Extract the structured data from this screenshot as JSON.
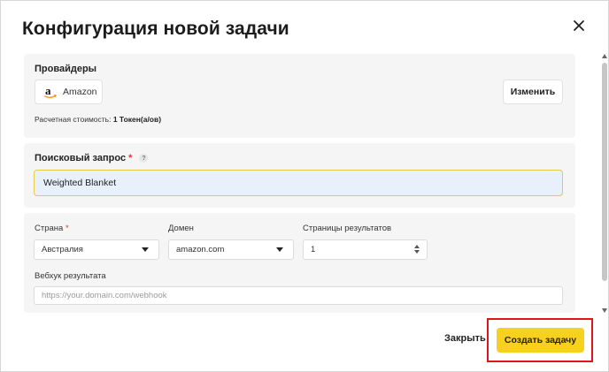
{
  "dialog": {
    "title": "Конфигурация новой задачи"
  },
  "providers": {
    "label": "Провайдеры",
    "selected": "Amazon",
    "change_button": "Изменить",
    "cost_label": "Расчетная стоимость:",
    "cost_value": "1 Токен(а/ов)"
  },
  "search": {
    "label": "Поисковый запрос",
    "required_mark": "*",
    "help_mark": "?",
    "value": "Weighted Blanket"
  },
  "options": {
    "country_label": "Страна",
    "country_required": "*",
    "country_value": "Австралия",
    "domain_label": "Домен",
    "domain_value": "amazon.com",
    "pages_label": "Страницы результатов",
    "pages_value": "1",
    "webhook_label": "Вебхук результата",
    "webhook_placeholder": "https://your.domain.com/webhook"
  },
  "footer": {
    "close_label": "Закрыть",
    "create_label": "Создать задачу"
  },
  "colors": {
    "accent": "#f8d01e",
    "highlight_border": "#e0141b",
    "search_bg": "#e7f0fb",
    "search_border": "#e6c84a"
  },
  "icons": [
    "close-icon",
    "amazon-logo-icon",
    "help-icon",
    "chevron-down-icon",
    "stepper-icon"
  ]
}
